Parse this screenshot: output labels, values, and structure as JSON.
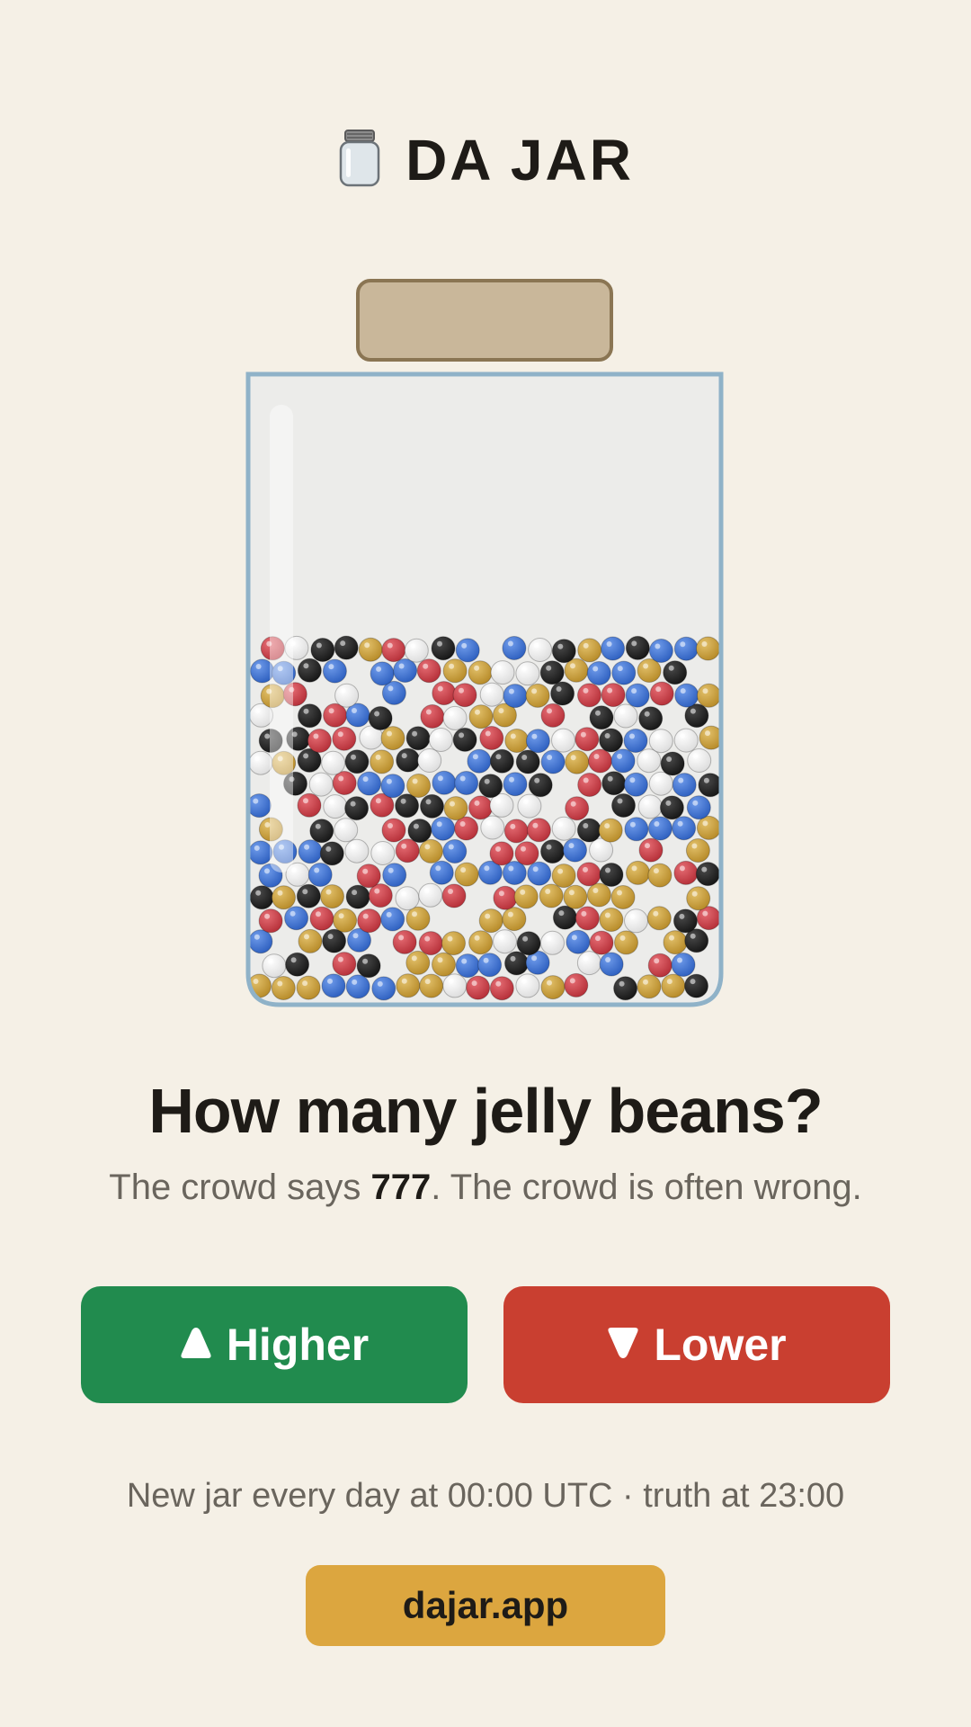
{
  "app": {
    "title": "DA JAR",
    "title_icon": "jar-icon"
  },
  "jar": {
    "lid_color": "#c9b79a",
    "lid_border": "#8a7553",
    "glass_border": "#8fb2c8",
    "glass_fill": "#ececea",
    "bean_colors": {
      "blue": "#3f72d0",
      "red": "#d0404a",
      "yellow": "#cfa33e",
      "black": "#262626",
      "white": "#f3f3f3"
    }
  },
  "main": {
    "question": "How many jelly beans?",
    "crowd_prefix": "The crowd says ",
    "crowd_number": "777",
    "crowd_suffix": ". The crowd is often wrong."
  },
  "buttons": {
    "higher_label": "Higher",
    "higher_icon": "up-triangle-icon",
    "higher_color": "#218b4e",
    "lower_label": "Lower",
    "lower_icon": "down-triangle-icon",
    "lower_color": "#c93f30"
  },
  "footer": {
    "note": "New jar every day at 00:00 UTC · truth at 23:00",
    "site_link": "dajar.app",
    "site_link_color": "#dca63f"
  }
}
